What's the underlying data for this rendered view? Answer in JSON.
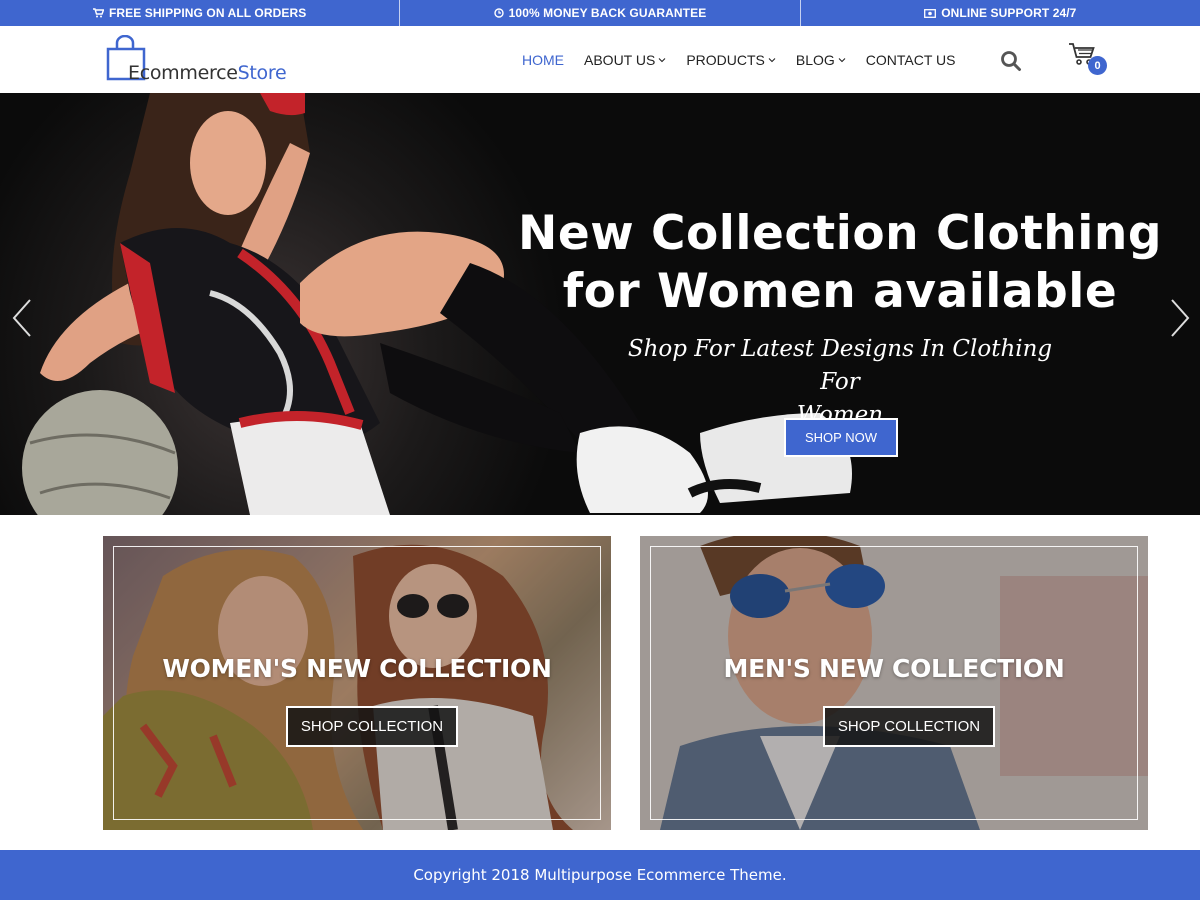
{
  "topbar": {
    "items": [
      {
        "icon": "cart-icon",
        "text": "FREE SHIPPING ON ALL ORDERS"
      },
      {
        "icon": "clock-icon",
        "text": "100% MONEY BACK GUARANTEE"
      },
      {
        "icon": "money-icon",
        "text": "ONLINE SUPPORT 24/7"
      }
    ]
  },
  "header": {
    "logo": {
      "part1": "Ecommerce",
      "part2": "Store"
    },
    "nav": [
      {
        "label": "HOME",
        "active": true,
        "dropdown": false
      },
      {
        "label": "ABOUT US",
        "active": false,
        "dropdown": true
      },
      {
        "label": "PRODUCTS",
        "active": false,
        "dropdown": true
      },
      {
        "label": "BLOG",
        "active": false,
        "dropdown": true
      },
      {
        "label": "CONTACT US",
        "active": false,
        "dropdown": false
      }
    ],
    "cart_count": "0"
  },
  "hero": {
    "title_line1": "New Collection Clothing",
    "title_line2": "for Women available",
    "subtitle_line1": "Shop For Latest Designs In Clothing For",
    "subtitle_line2": "Women",
    "button": "SHOP NOW"
  },
  "collections": [
    {
      "title": "WOMEN'S NEW COLLECTION",
      "button": "SHOP COLLECTION"
    },
    {
      "title": "MEN'S NEW COLLECTION",
      "button": "SHOP COLLECTION"
    }
  ],
  "footer": {
    "copyright": "Copyright 2018 Multipurpose Ecommerce Theme."
  },
  "colors": {
    "accent": "#3f66cf",
    "text": "#222222"
  }
}
